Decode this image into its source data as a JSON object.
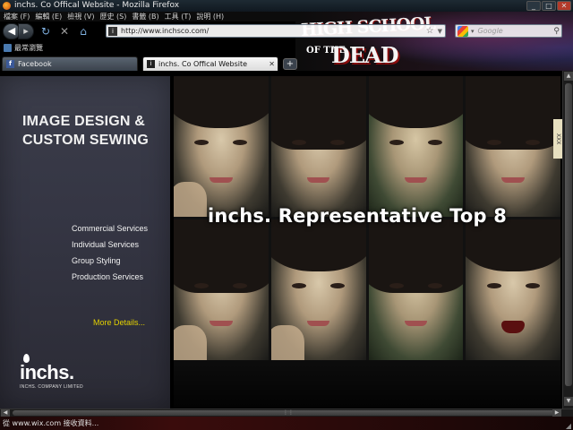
{
  "window": {
    "title": "inchs. Co Offical Website - Mozilla Firefox"
  },
  "menu": {
    "items": [
      "檔案 (F)",
      "編輯 (E)",
      "檢視 (V)",
      "歷史 (S)",
      "書籤 (B)",
      "工具 (T)",
      "說明 (H)"
    ]
  },
  "persona": {
    "line1": "HIGH SCHOOL",
    "of": "OF THE",
    "line2": "DEAD"
  },
  "navbar": {
    "url": "http://www.inchsco.com/",
    "search_placeholder": "Google"
  },
  "bookmarks": {
    "label": "最常瀏覽"
  },
  "tabs": [
    {
      "title": "Facebook",
      "icon": "facebook-icon"
    },
    {
      "title": "inchs. Co Offical Website",
      "icon": "site-icon"
    }
  ],
  "page": {
    "headline_line1": "IMAGE DESIGN &",
    "headline_line2": "CUSTOM SEWING",
    "services": [
      "Commercial Services",
      "Individual Services",
      "Group Styling",
      "Production Services"
    ],
    "more_link": "More Details...",
    "brand": "inchs.",
    "brand_sub": "INCHS. COMPANY LIMITED",
    "overlay_title": "inchs. Representative Top 8",
    "side_tab": "XXX"
  },
  "status": {
    "text": "從 www.wix.com 接收資料..."
  },
  "colors": {
    "more_link": "#e4d200",
    "left_panel": "#3b3d4a"
  }
}
